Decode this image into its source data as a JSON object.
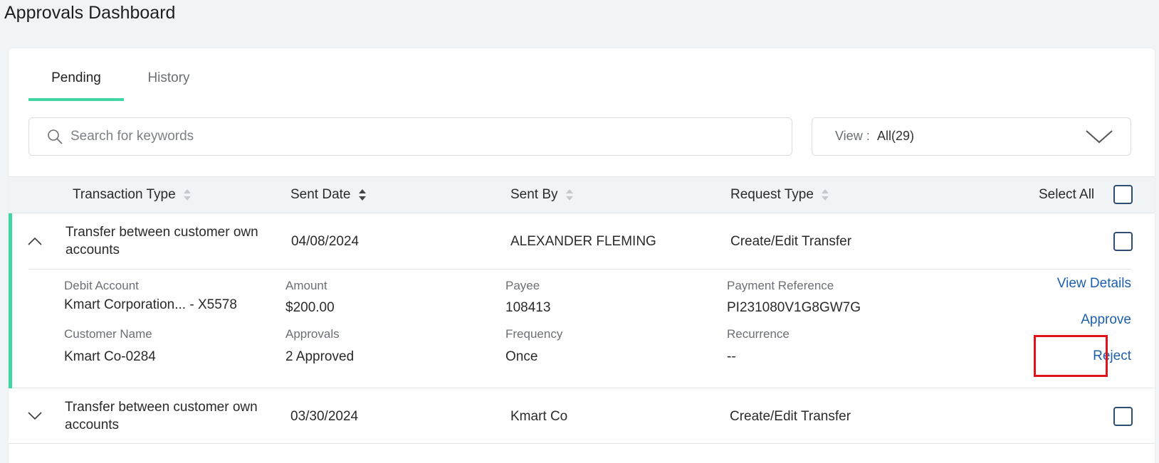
{
  "page_title": "Approvals Dashboard",
  "tabs": [
    {
      "label": "Pending",
      "active": true
    },
    {
      "label": "History",
      "active": false
    }
  ],
  "search": {
    "placeholder": "Search for keywords",
    "value": ""
  },
  "view_filter": {
    "label": "View :",
    "value": "All(29)"
  },
  "table": {
    "headers": {
      "transaction_type": "Transaction Type",
      "sent_date": "Sent Date",
      "sent_by": "Sent By",
      "request_type": "Request Type",
      "select_all": "Select All"
    },
    "rows": [
      {
        "transaction_type": "Transfer between customer own accounts",
        "sent_date": "04/08/2024",
        "sent_by": "ALEXANDER FLEMING",
        "request_type": "Create/Edit Transfer",
        "expanded": true,
        "details": {
          "debit_account_label": "Debit Account",
          "debit_account": "Kmart Corporation... - X5578",
          "amount_label": "Amount",
          "amount": "$200.00",
          "payee_label": "Payee",
          "payee": "108413",
          "payment_reference_label": "Payment Reference",
          "payment_reference": "PI231080V1G8GW7G",
          "customer_name_label": "Customer Name",
          "customer_name": "Kmart Co-0284",
          "approvals_label": "Approvals",
          "approvals": "2 Approved",
          "frequency_label": "Frequency",
          "frequency": "Once",
          "recurrence_label": "Recurrence",
          "recurrence": "--"
        },
        "actions": {
          "view_details": "View Details",
          "approve": "Approve",
          "reject": "Reject"
        }
      },
      {
        "transaction_type": "Transfer between customer own accounts",
        "sent_date": "03/30/2024",
        "sent_by": "Kmart Co",
        "request_type": "Create/Edit Transfer",
        "expanded": false
      }
    ]
  },
  "colors": {
    "accent": "#3fd6a4",
    "link": "#1d5fad",
    "highlight": "#e0121a",
    "checkbox_border": "#2e4d73"
  },
  "icons": {
    "search": "search-icon",
    "view_dropdown": "chevron-down-icon",
    "sort": "sort-icon",
    "expand": "chevron-up-icon",
    "collapse": "chevron-down-icon"
  }
}
